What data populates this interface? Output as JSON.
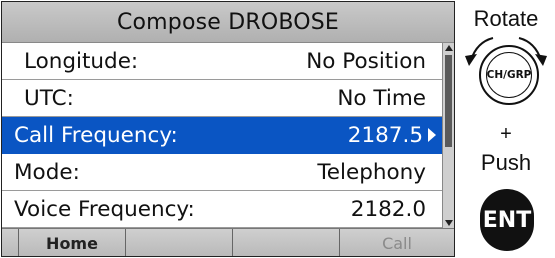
{
  "screen": {
    "title": "Compose DROBOSE",
    "rows": [
      {
        "label": "Longitude:",
        "value": "No Position"
      },
      {
        "label": "UTC:",
        "value": "No Time"
      },
      {
        "label": "Call Frequency:",
        "value": "2187.5"
      },
      {
        "label": "Mode:",
        "value": "Telephony"
      },
      {
        "label": "Voice Frequency:",
        "value": "2182.0"
      }
    ],
    "softkeys": [
      "Home",
      "",
      "",
      "Call"
    ]
  },
  "side": {
    "rotate_label": "Rotate",
    "knob_label": "CH/GRP",
    "plus": "+",
    "push_label": "Push",
    "ent_label": "ENT"
  },
  "colors": {
    "selection": "#0a55c3"
  }
}
